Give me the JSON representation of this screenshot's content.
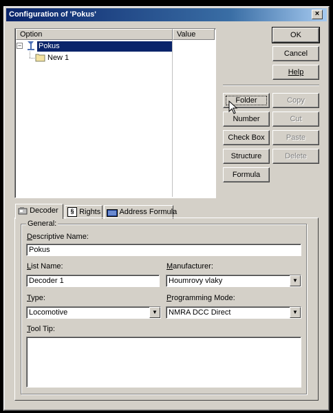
{
  "window": {
    "title": "Configuration of 'Pokus'",
    "close_glyph": "×"
  },
  "list": {
    "columns": [
      "Option",
      "Value"
    ],
    "tree": [
      {
        "label": "Pokus",
        "selected": true,
        "expander": "⊟"
      },
      {
        "label": "New 1",
        "selected": false
      }
    ]
  },
  "dialog_buttons": {
    "ok": "OK",
    "cancel": "Cancel",
    "help": "Help"
  },
  "action_buttons": {
    "folder": "Folder",
    "number": "Number",
    "checkbox": "Check Box",
    "structure": "Structure",
    "formula": "Formula",
    "copy": "Copy",
    "cut": "Cut",
    "paste": "Paste",
    "delete": "Delete"
  },
  "tabs": {
    "decoder": "Decoder",
    "rights": "Rights",
    "address_formula": "Address Formula",
    "active": "decoder"
  },
  "decoder": {
    "group_label": "General:",
    "descriptive_name_label": "Descriptive Name:",
    "descriptive_name": "Pokus",
    "list_name_label": "List Name:",
    "list_name": "Decoder 1",
    "manufacturer_label": "Manufacturer:",
    "manufacturer": "Houmrovy vlaky",
    "type_label": "Type:",
    "type": "Locomotive",
    "programming_mode_label": "Programming Mode:",
    "programming_mode": "NMRA DCC Direct",
    "tooltip_label": "Tool Tip:",
    "tooltip": ""
  },
  "colors": {
    "face": "#d4d0c8",
    "title_start": "#0a246a",
    "title_end": "#a6caf0",
    "selection": "#0a246a"
  }
}
